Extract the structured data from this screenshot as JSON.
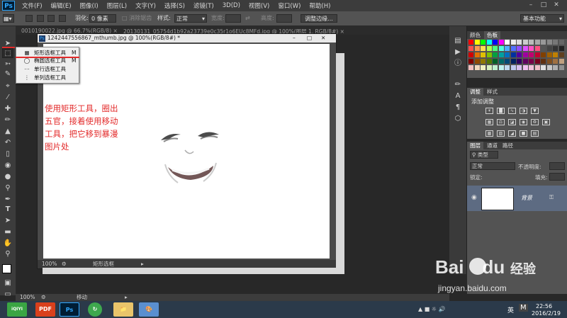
{
  "menu": {
    "logo": "Ps",
    "items": [
      "文件(F)",
      "编辑(E)",
      "图像(I)",
      "图层(L)",
      "文字(Y)",
      "选择(S)",
      "滤镜(T)",
      "3D(D)",
      "视图(V)",
      "窗口(W)",
      "帮助(H)"
    ]
  },
  "options": {
    "feather_label": "羽化:",
    "feather_value": "0 像素",
    "antialias_label": "消除锯齿",
    "style_label": "样式:",
    "style_value": "正常",
    "width_label": "宽度:",
    "height_label": "高度:",
    "refine_edge": "调整边缘...",
    "workspace": "基本功能"
  },
  "doc_tabs": [
    "0010190022.jpg @ 66.7%(RGB/8) ×",
    "20130131_05754d1b92a23739e0c35r1o6EUc8MFd.jpg @ 100%(图层 1, RGB/8#) ×"
  ],
  "document": {
    "title": "1242447556867_mthumb.jpg @ 100%(RGB/8#) *",
    "zoom": "100%",
    "status_tool": "矩形选框"
  },
  "flyout": [
    {
      "label": "矩形选框工具",
      "key": "M"
    },
    {
      "label": "椭圆选框工具",
      "key": "M"
    },
    {
      "label": "单行选框工具",
      "key": ""
    },
    {
      "label": "单列选框工具",
      "key": ""
    }
  ],
  "annotation": [
    "使用矩形工具，圈出",
    "五官，接着使用移动",
    "工具，把它移到暴漫",
    "图片处"
  ],
  "panels": {
    "color_tabs": [
      "颜色",
      "色板"
    ],
    "adjust_tabs": [
      "调整",
      "样式"
    ],
    "adjust_title": "添加调整",
    "layers_tabs": [
      "图层",
      "通道",
      "路径"
    ],
    "kind_label": "类型",
    "blend_mode": "正常",
    "opacity_label": "不透明度:",
    "lock_label": "锁定:",
    "fill_label": "填充:",
    "layer_name": "背景"
  },
  "statusbar": {
    "zoom": "100%",
    "tool": "移动"
  },
  "taskbar": {
    "time": "22:56",
    "date": "2016/2/19",
    "lang": "英",
    "apps": [
      "iQIYI",
      "PDF",
      "Ps",
      "",
      "",
      ""
    ]
  },
  "watermark": {
    "brand": "Bai",
    "brand2": "du",
    "cn": "经验",
    "url": "jingyan.baidu.com"
  },
  "colors": {
    "annotation": "#e32b2b",
    "photoshop_blue": "#31a8ff"
  }
}
